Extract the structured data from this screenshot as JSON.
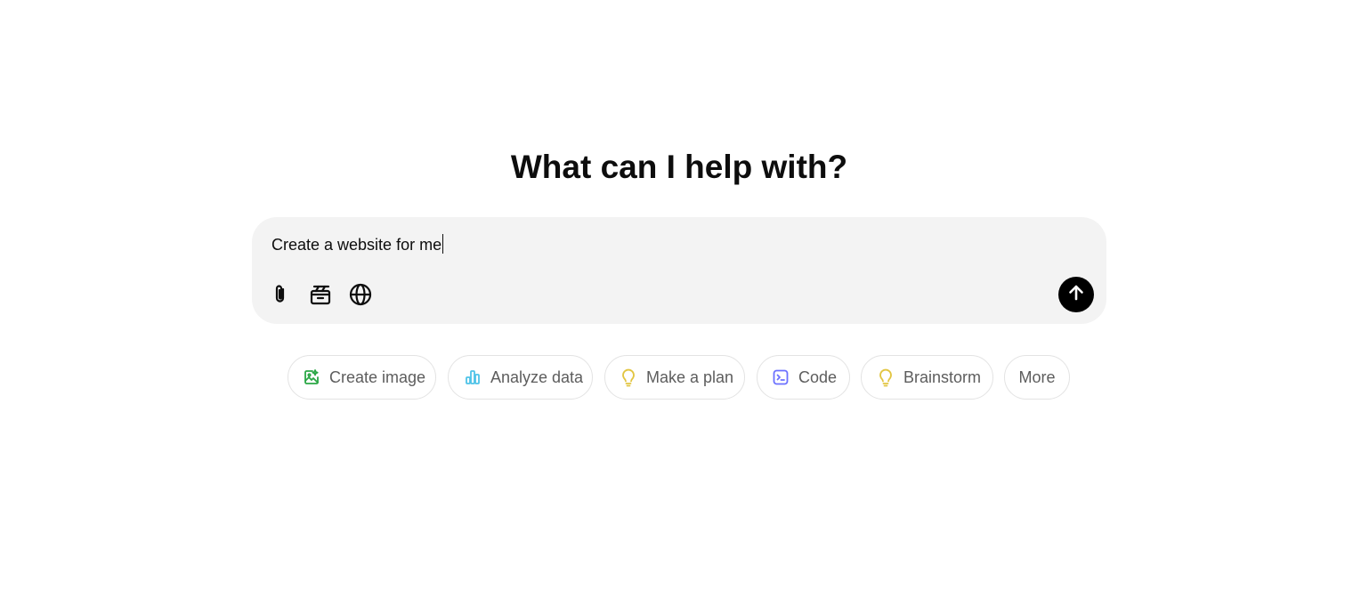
{
  "heading": "What can I help with?",
  "composer": {
    "input_value": "Create a website for me",
    "tools": [
      {
        "icon": "paperclip-icon"
      },
      {
        "icon": "canvas-icon"
      },
      {
        "icon": "globe-icon"
      }
    ],
    "send_icon": "arrow-up-icon"
  },
  "suggestions": [
    {
      "label": "Create image",
      "icon": "image-edit-icon",
      "color": "#2aa745"
    },
    {
      "label": "Analyze data",
      "icon": "bar-chart-icon",
      "color": "#4fc3e8"
    },
    {
      "label": "Make a plan",
      "icon": "lightbulb-icon",
      "color": "#e2c541"
    },
    {
      "label": "Code",
      "icon": "terminal-icon",
      "color": "#6c71ff"
    },
    {
      "label": "Brainstorm",
      "icon": "lightbulb-icon",
      "color": "#e2c541"
    },
    {
      "label": "More"
    }
  ]
}
